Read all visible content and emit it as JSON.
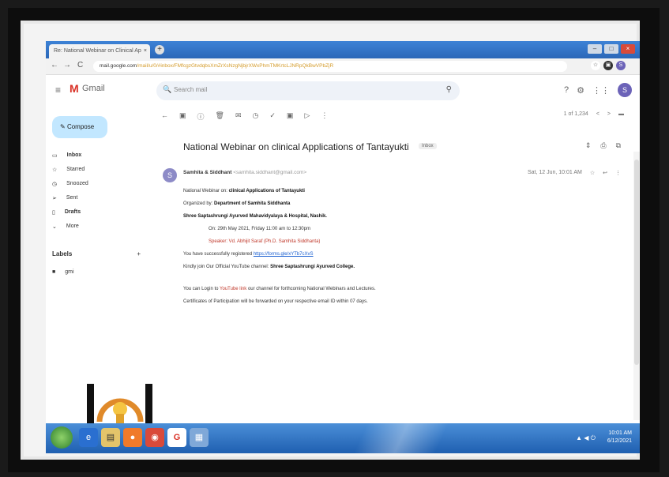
{
  "browser": {
    "tab_title": "Re: National Webinar on Clinical Ap",
    "tab_close": "×",
    "new_tab": "+",
    "url_domain": "mail.google.com",
    "url_path": "/mail/u/0/#inbox/FMfcgzGtvdqbsXmZrXsNzgNjbjrXWxPhmTMKrtcLJNRpQkBwVPbZjR",
    "nav_back": "←",
    "nav_forward": "→",
    "nav_reload": "C",
    "min": "–",
    "max": "□",
    "close": "×"
  },
  "gmail": {
    "menu_icon": "≡",
    "logo_letter": "M",
    "logo_text": "Gmail",
    "search_placeholder": "Search mail",
    "avatar_letter": "S",
    "compose_label": "Compose"
  },
  "sidebar": {
    "items": [
      {
        "label": "Inbox",
        "icon": "▭",
        "count": "",
        "bold": true
      },
      {
        "label": "Starred",
        "icon": "☆",
        "count": ""
      },
      {
        "label": "Snoozed",
        "icon": "◷",
        "count": ""
      },
      {
        "label": "Sent",
        "icon": "➢",
        "count": ""
      },
      {
        "label": "Drafts",
        "icon": "▯",
        "count": "",
        "bold": true
      },
      {
        "label": "More",
        "icon": "⌄",
        "count": ""
      }
    ],
    "labels_heading": "Labels",
    "labels_add": "+",
    "label_items": [
      {
        "label": "gmi",
        "icon": "■"
      }
    ]
  },
  "toolbar": {
    "icons": [
      "←",
      "▣",
      "ⓘ",
      "🗑",
      "✉",
      "◷",
      "✓",
      "▣",
      "▷",
      "⋮"
    ],
    "pager": "1 of 1,234",
    "prev": "<",
    "next": ">",
    "keyboard": "▬"
  },
  "email": {
    "subject": "National Webinar on clinical Applications of Tantayukti",
    "badge": "Inbox",
    "subject_icons": [
      "⇕",
      "⎙",
      "⧉"
    ],
    "sender_avatar": "S",
    "sender_name": "Samhita & Siddhant",
    "sender_email": "<samhita.siddhant@gmail.com>",
    "time": "Sat, 12 Jun, 10:01 AM",
    "star": "☆",
    "reply": "↩",
    "more": "⋮",
    "body": {
      "l1_a": "National Webinar on:",
      "l1_b": "clinical Applications of Tantayukti",
      "l2_a": "Organized by:",
      "l2_b": "Department of Samhita Siddhanta",
      "l3": "Shree Saptashrungi Ayurved Mahavidyalaya & Hospital, Nashik.",
      "l4": "On: 29th May 2021, Friday 11:00 am to 12:30pm",
      "l5": "Speaker: Vd. Abhijit Saraf (Ph.D. Samhita Siddhanta)",
      "l6_a": "You have successfully registered",
      "l6_b": "https://forms.gle/xYTb7cXvS",
      "l7_a": "Kindly join Our Official YouTube channel:",
      "l7_b": "Shree Saptashrungi Ayurved College.",
      "l8_a": "You can Login to",
      "l8_red": "YouTube link",
      "l8_b": "our channel for forthcoming National Webinars and Lectures.",
      "l9": "Certificates of Participation will be forwarded on your respective email ID within 07 days."
    }
  },
  "taskbar": {
    "apps": [
      "e",
      "▤",
      "●",
      "◉",
      "G",
      "▦"
    ],
    "time": "10:01 AM",
    "date": "6/12/2021",
    "tray": "▲ ◀ ⏻"
  }
}
